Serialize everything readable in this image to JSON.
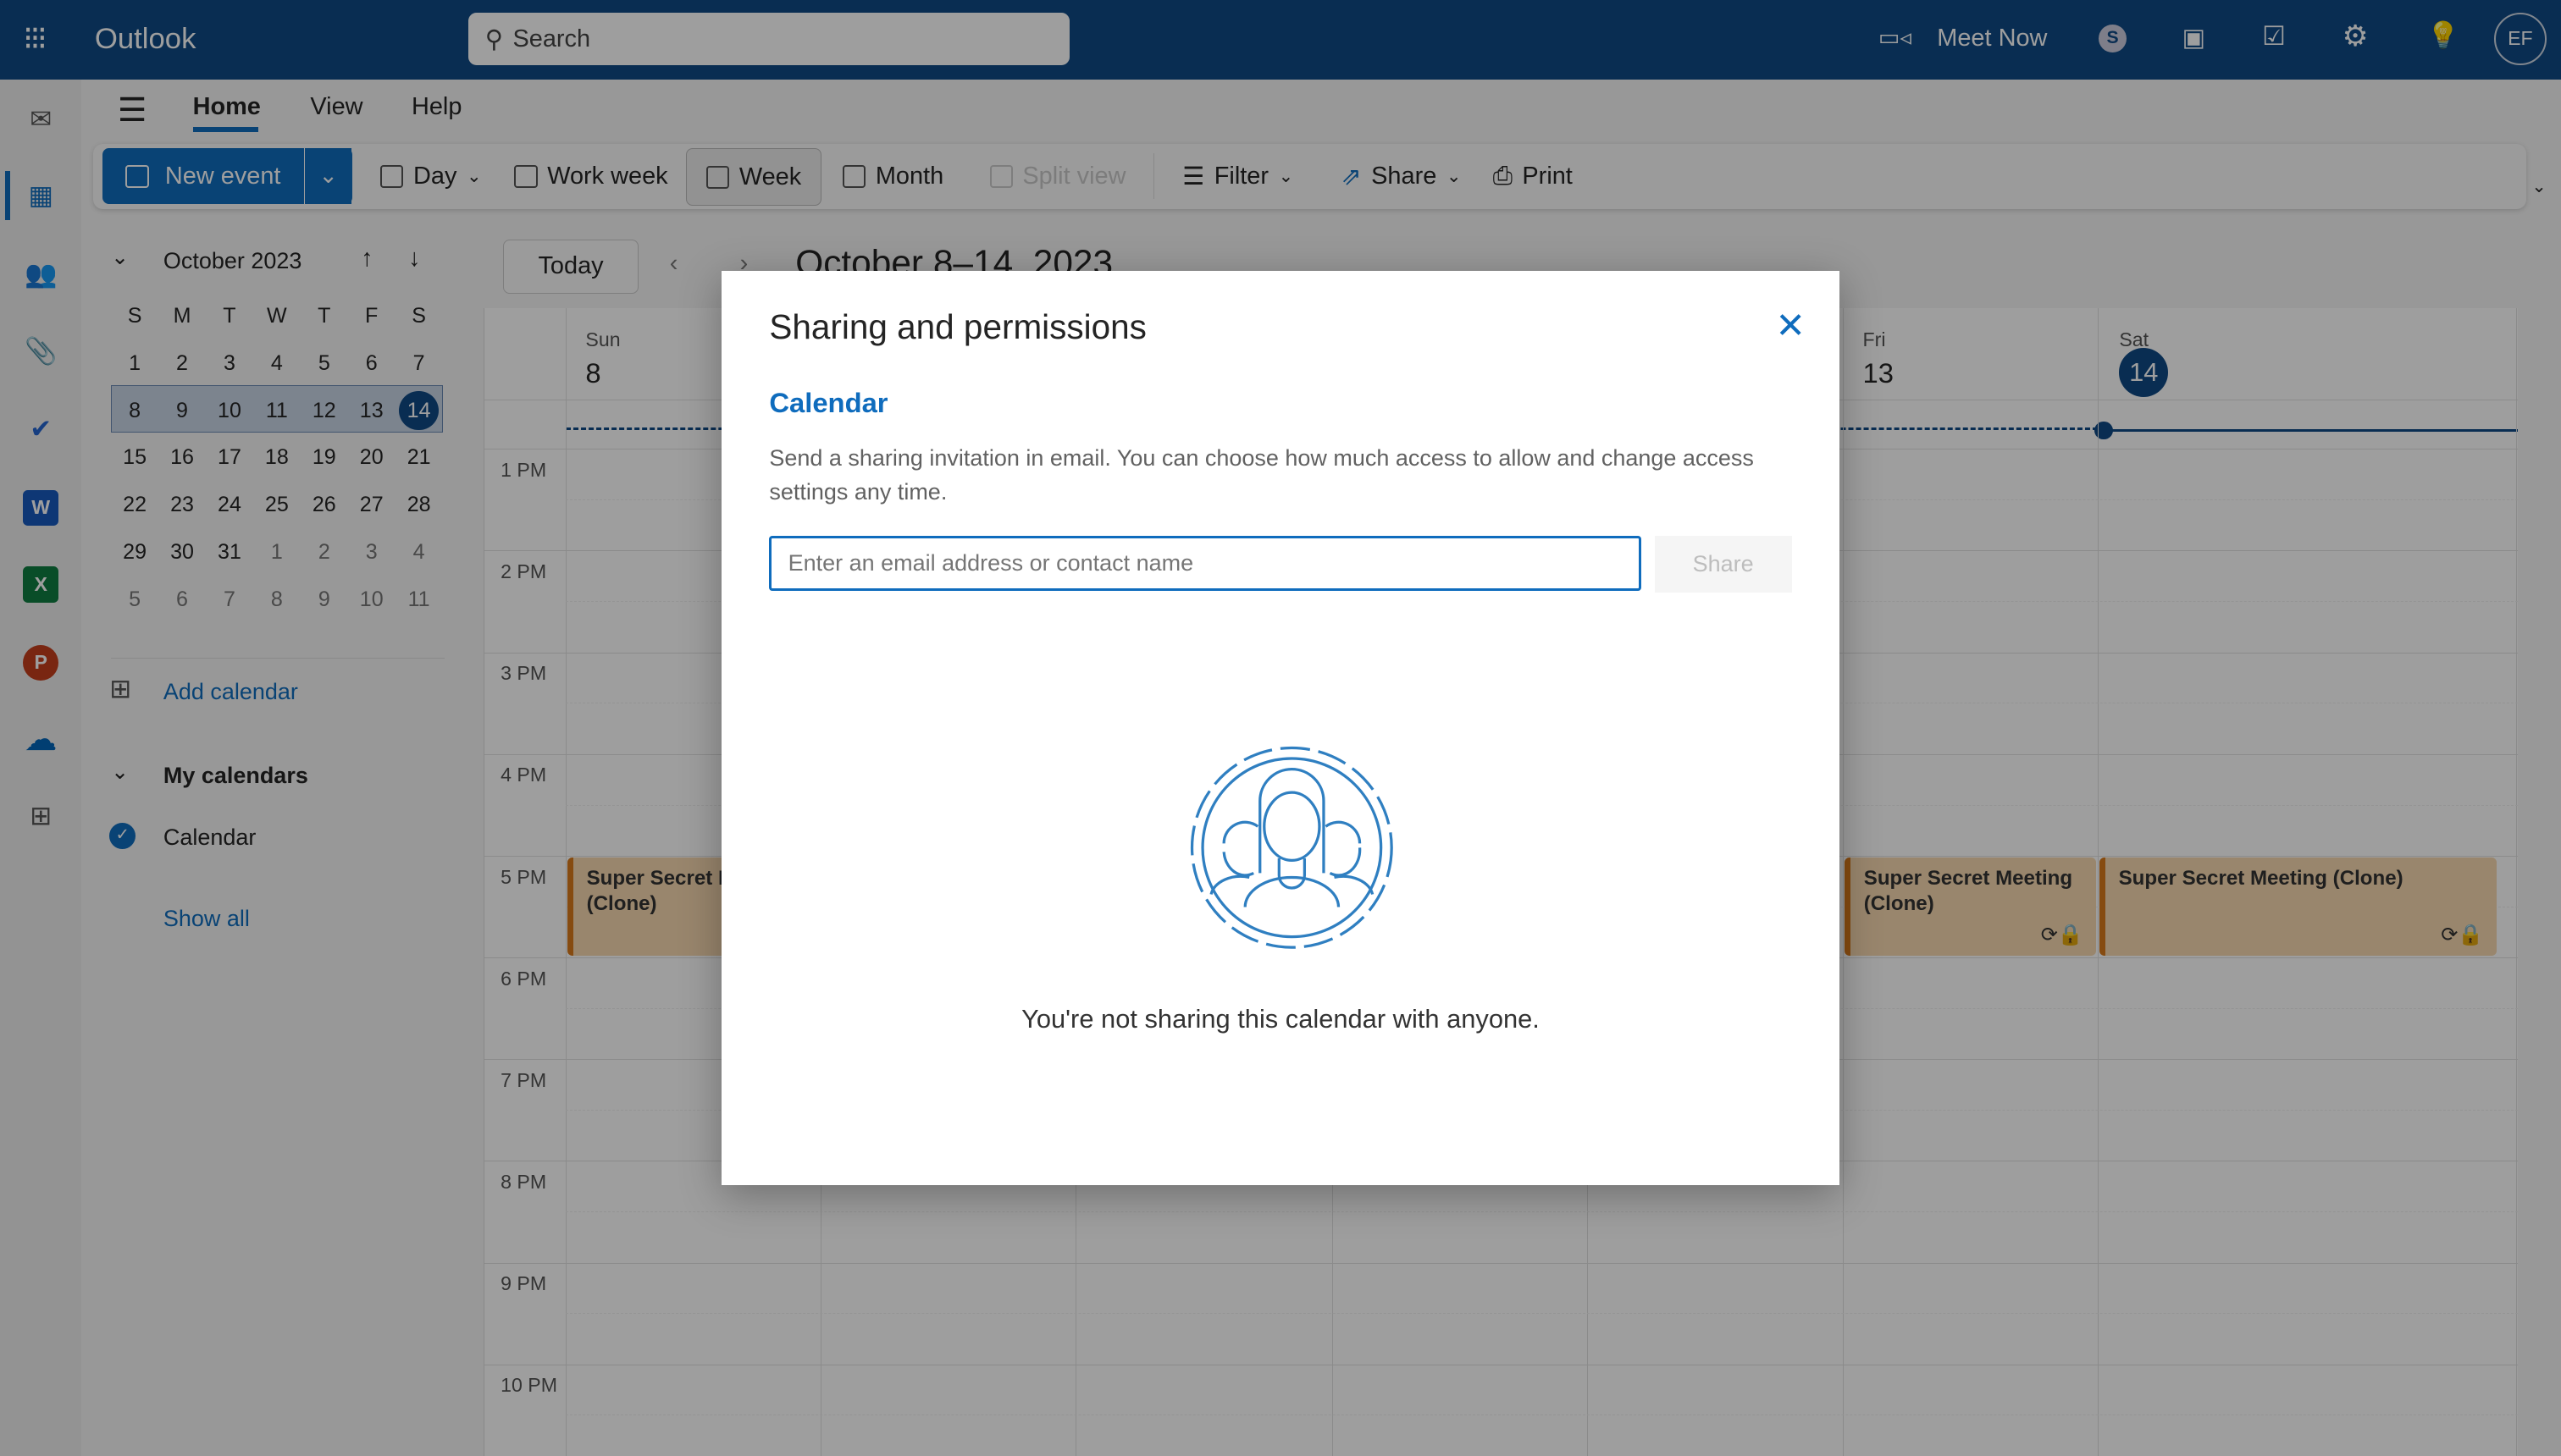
{
  "app": {
    "title": "Outlook",
    "search_placeholder": "Search",
    "meet_now": "Meet Now",
    "avatar": "EF"
  },
  "tabs": [
    "Home",
    "View",
    "Help"
  ],
  "ribbon": {
    "new_event": "New event",
    "day": "Day",
    "work_week": "Work week",
    "week": "Week",
    "month": "Month",
    "split_view": "Split view",
    "filter": "Filter",
    "share": "Share",
    "print": "Print"
  },
  "mini_calendar": {
    "title": "October 2023",
    "weekdays": [
      "S",
      "M",
      "T",
      "W",
      "T",
      "F",
      "S"
    ],
    "weeks": [
      [
        "1",
        "2",
        "3",
        "4",
        "5",
        "6",
        "7"
      ],
      [
        "8",
        "9",
        "10",
        "11",
        "12",
        "13",
        "14"
      ],
      [
        "15",
        "16",
        "17",
        "18",
        "19",
        "20",
        "21"
      ],
      [
        "22",
        "23",
        "24",
        "25",
        "26",
        "27",
        "28"
      ],
      [
        "29",
        "30",
        "31",
        "1",
        "2",
        "3",
        "4"
      ],
      [
        "5",
        "6",
        "7",
        "8",
        "9",
        "10",
        "11"
      ]
    ],
    "selected_week": 1,
    "today": "14"
  },
  "sidebar": {
    "add_calendar": "Add calendar",
    "my_calendars": "My calendars",
    "calendar": "Calendar",
    "show_all": "Show all"
  },
  "calendar": {
    "today_button": "Today",
    "range": "October 8–14, 2023",
    "days": [
      {
        "name": "Sun",
        "date": "8"
      },
      {
        "name": "Fri",
        "date": "13"
      },
      {
        "name": "Sat",
        "date": "14"
      }
    ],
    "times": [
      "1 PM",
      "2 PM",
      "3 PM",
      "4 PM",
      "5 PM",
      "6 PM",
      "7 PM",
      "8 PM",
      "9 PM",
      "10 PM"
    ],
    "events": [
      {
        "title": "Super Secret Meeting (Clone)",
        "day": "Sun",
        "time": "5 PM"
      },
      {
        "title": "Super Secret Meeting (Clone)",
        "day": "Fri",
        "time": "5 PM"
      },
      {
        "title": "Super Secret Meeting (Clone)",
        "day": "Sat",
        "time": "5 PM"
      }
    ]
  },
  "dialog": {
    "title": "Sharing and permissions",
    "section": "Calendar",
    "description": "Send a sharing invitation in email. You can choose how much access to allow and change access settings any time.",
    "input_placeholder": "Enter an email address or contact name",
    "share_button": "Share",
    "empty_message": "You're not sharing this calendar with anyone."
  },
  "colors": {
    "brand": "#0f4a85",
    "accent": "#0f6cbd",
    "event": "#f7d9b0",
    "event_border": "#d97a1a"
  }
}
